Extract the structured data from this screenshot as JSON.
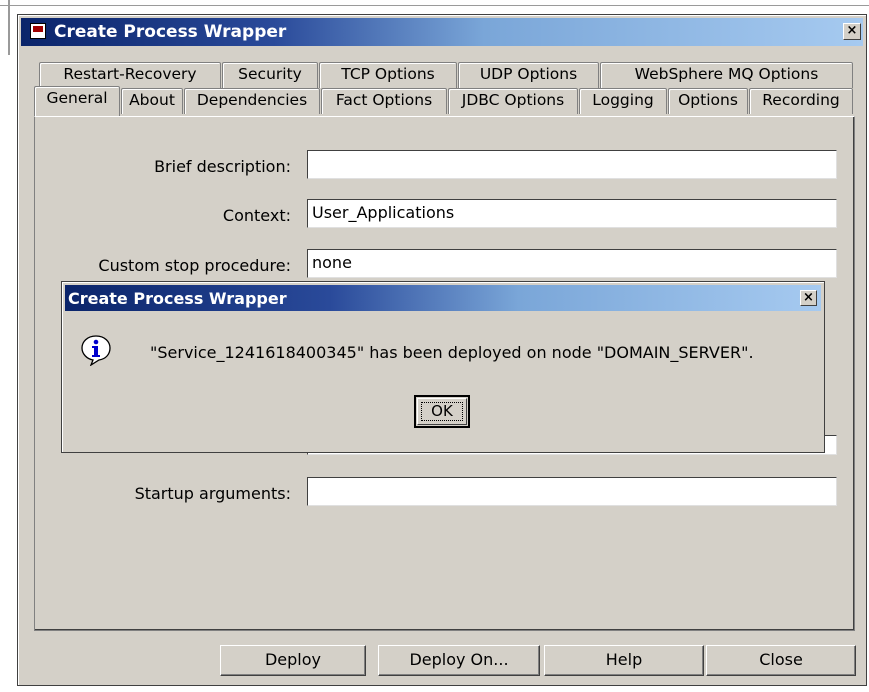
{
  "window": {
    "title": "Create Process Wrapper",
    "close_glyph": "×"
  },
  "tabs_back": [
    {
      "label": "Restart-Recovery"
    },
    {
      "label": "Security"
    },
    {
      "label": "TCP Options"
    },
    {
      "label": "UDP Options"
    },
    {
      "label": "WebSphere MQ Options"
    }
  ],
  "tabs_front": [
    {
      "label": "General",
      "active": true
    },
    {
      "label": "About"
    },
    {
      "label": "Dependencies"
    },
    {
      "label": "Fact Options"
    },
    {
      "label": "JDBC Options"
    },
    {
      "label": "Logging"
    },
    {
      "label": "Options"
    },
    {
      "label": "Recording"
    }
  ],
  "form": {
    "brief_description": {
      "label": "Brief description:",
      "value": ""
    },
    "context": {
      "label": "Context:",
      "value": "User_Applications"
    },
    "custom_stop_procedure": {
      "label": "Custom stop procedure:",
      "value": "none"
    },
    "startup_arguments": {
      "label": "Startup arguments:",
      "value": ""
    }
  },
  "buttons": {
    "deploy": "Deploy",
    "deploy_on": "Deploy On...",
    "help": "Help",
    "close": "Close"
  },
  "dialog": {
    "title": "Create Process Wrapper",
    "message": "\"Service_1241618400345\" has been deployed on node \"DOMAIN_SERVER\".",
    "ok_label": "OK",
    "icon": "info-icon",
    "close_glyph": "×"
  },
  "colors": {
    "titlebar_start": "#0a246a",
    "titlebar_end": "#a6caf0",
    "face": "#d4d0c8"
  }
}
